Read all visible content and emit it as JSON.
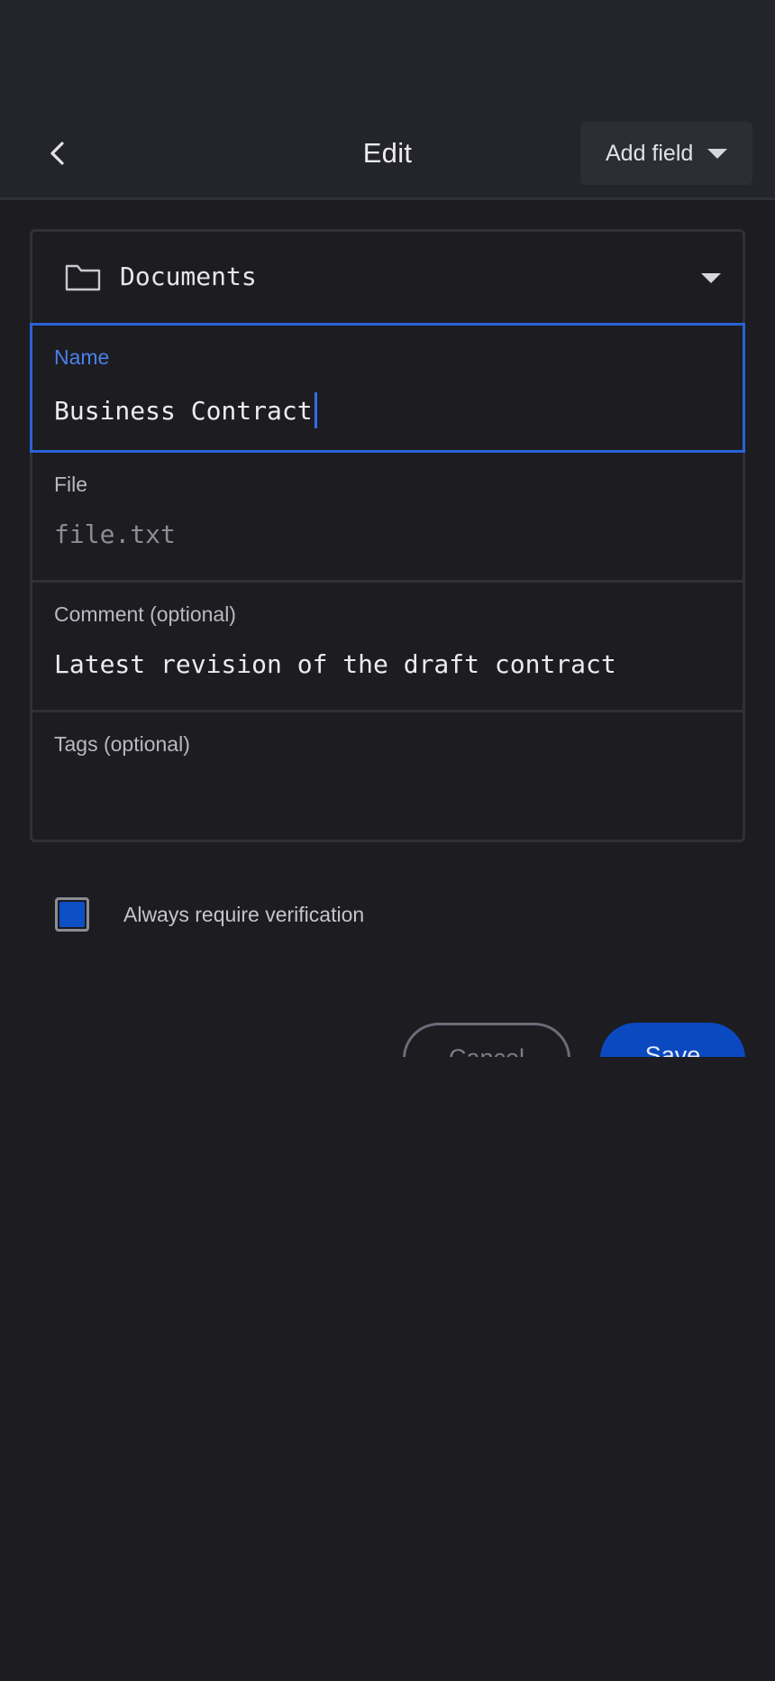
{
  "header": {
    "title": "Edit",
    "add_field_label": "Add field",
    "back_icon": "chevron-left-icon"
  },
  "form": {
    "folder": {
      "icon": "folder-icon",
      "value": "Documents"
    },
    "name": {
      "label": "Name",
      "value": "Business Contract"
    },
    "file": {
      "label": "File",
      "value": "file.txt"
    },
    "comment": {
      "label": "Comment (optional)",
      "value": "Latest revision of the draft contract"
    },
    "tags": {
      "label": "Tags (optional)",
      "value": ""
    }
  },
  "verification": {
    "label": "Always require verification",
    "checked": true
  },
  "actions": {
    "cancel_label": "Cancel",
    "save_label": "Save"
  },
  "colors": {
    "accent": "#2a62d6",
    "primary_button": "#0a49bf",
    "background": "#1c1c21",
    "header": "#24252b"
  }
}
